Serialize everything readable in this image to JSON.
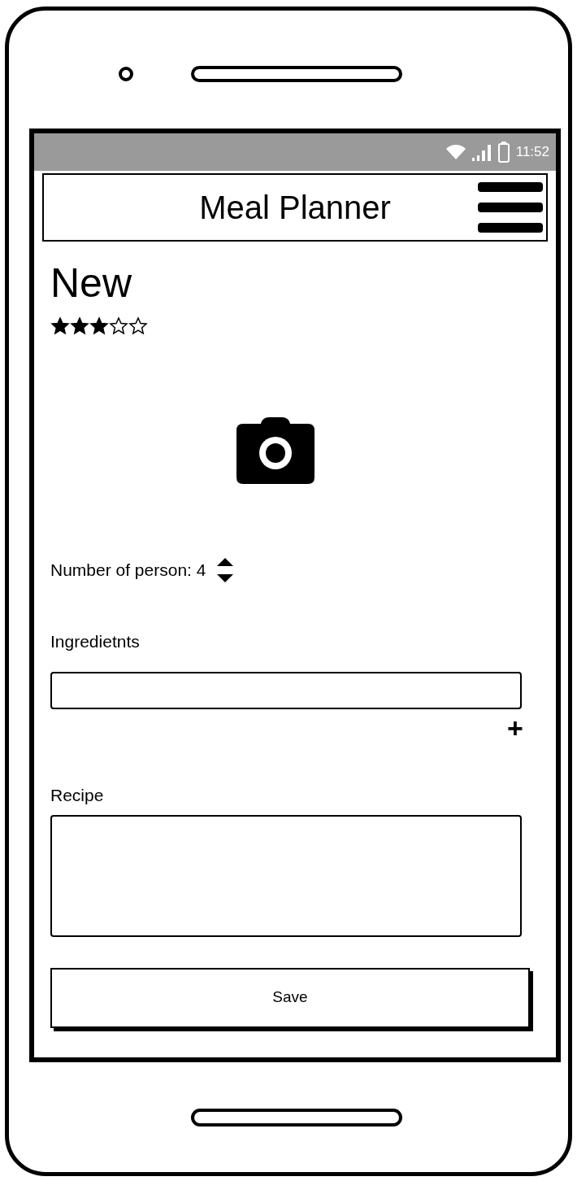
{
  "status_bar": {
    "time": "11:52"
  },
  "header": {
    "title": "Meal Planner"
  },
  "recipe_form": {
    "title": "New",
    "stars": 3,
    "persons_label": "Number of person: 4",
    "ingredients_label": "Ingredietnts",
    "add_button": "+",
    "recipe_label": "Recipe",
    "save_button": "Save"
  }
}
